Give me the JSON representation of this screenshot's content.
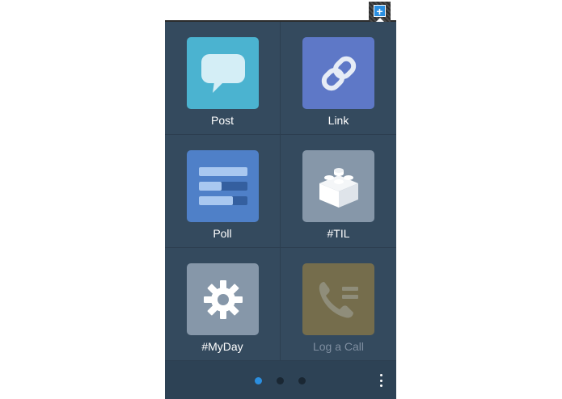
{
  "colors": {
    "panel": "#344a5e",
    "post_tile": "#4bb3d0",
    "link_tile": "#5e78c7",
    "poll_tile": "#4f80c8",
    "til_tile": "#8697a9",
    "myday_tile": "#8697a9",
    "logacall_tile": "#756d4c",
    "accent": "#2b8fe0"
  },
  "header": {
    "add_button_icon": "plus-icon",
    "add_button_label": "+"
  },
  "actions": [
    {
      "label": "Post",
      "icon": "speech-bubble-icon",
      "enabled": true
    },
    {
      "label": "Link",
      "icon": "chain-link-icon",
      "enabled": true
    },
    {
      "label": "Poll",
      "icon": "poll-bars-icon",
      "enabled": true
    },
    {
      "label": "#TIL",
      "icon": "brick-icon",
      "enabled": true
    },
    {
      "label": "#MyDay",
      "icon": "gear-icon",
      "enabled": true
    },
    {
      "label": "Log a Call",
      "icon": "phone-icon",
      "enabled": false
    }
  ],
  "pager": {
    "pages": 3,
    "current_page": 1
  },
  "footer": {
    "more_icon": "kebab-menu-icon"
  }
}
